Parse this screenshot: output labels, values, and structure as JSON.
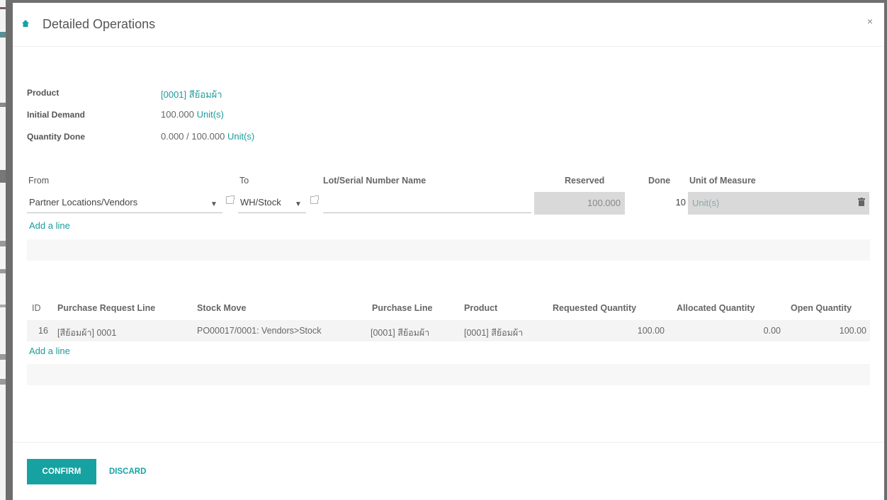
{
  "dialog": {
    "title": "Detailed Operations",
    "close": "×"
  },
  "summary": {
    "product_label": "Product",
    "product_value": "[0001] สีย้อมผ้า",
    "initial_demand_label": "Initial Demand",
    "initial_demand_value": "100.000",
    "initial_demand_uom": "Unit(s)",
    "qty_done_label": "Quantity Done",
    "qty_done_value": "0.000 / 100.000",
    "qty_done_uom": "Unit(s)"
  },
  "move_lines": {
    "headers": {
      "from": "From",
      "to": "To",
      "lot": "Lot/Serial Number Name",
      "reserved": "Reserved",
      "done": "Done",
      "uom": "Unit of Measure"
    },
    "row": {
      "from": "Partner Locations/Vendors",
      "to": "WH/Stock",
      "lot": "",
      "reserved": "100.000",
      "done": "10",
      "uom": "Unit(s)"
    },
    "add_line": "Add a line"
  },
  "request_lines": {
    "headers": {
      "id": "ID",
      "pr_line": "Purchase Request Line",
      "stock_move": "Stock Move",
      "purchase_line": "Purchase Line",
      "product": "Product",
      "requested": "Requested Quantity",
      "allocated": "Allocated Quantity",
      "open": "Open Quantity"
    },
    "rows": [
      {
        "id": "16",
        "pr_line": "[สีย้อมผ้า] 0001",
        "stock_move": "PO00017/0001: Vendors>Stock",
        "purchase_line": "[0001] สีย้อมผ้า",
        "product": "[0001] สีย้อมผ้า",
        "requested": "100.00",
        "allocated": "0.00",
        "open": "100.00"
      }
    ],
    "add_line": "Add a line"
  },
  "footer": {
    "confirm": "CONFIRM",
    "discard": "DISCARD"
  },
  "colors": {
    "accent": "#17a2a2",
    "readonly_bg": "#d9d9d9"
  }
}
